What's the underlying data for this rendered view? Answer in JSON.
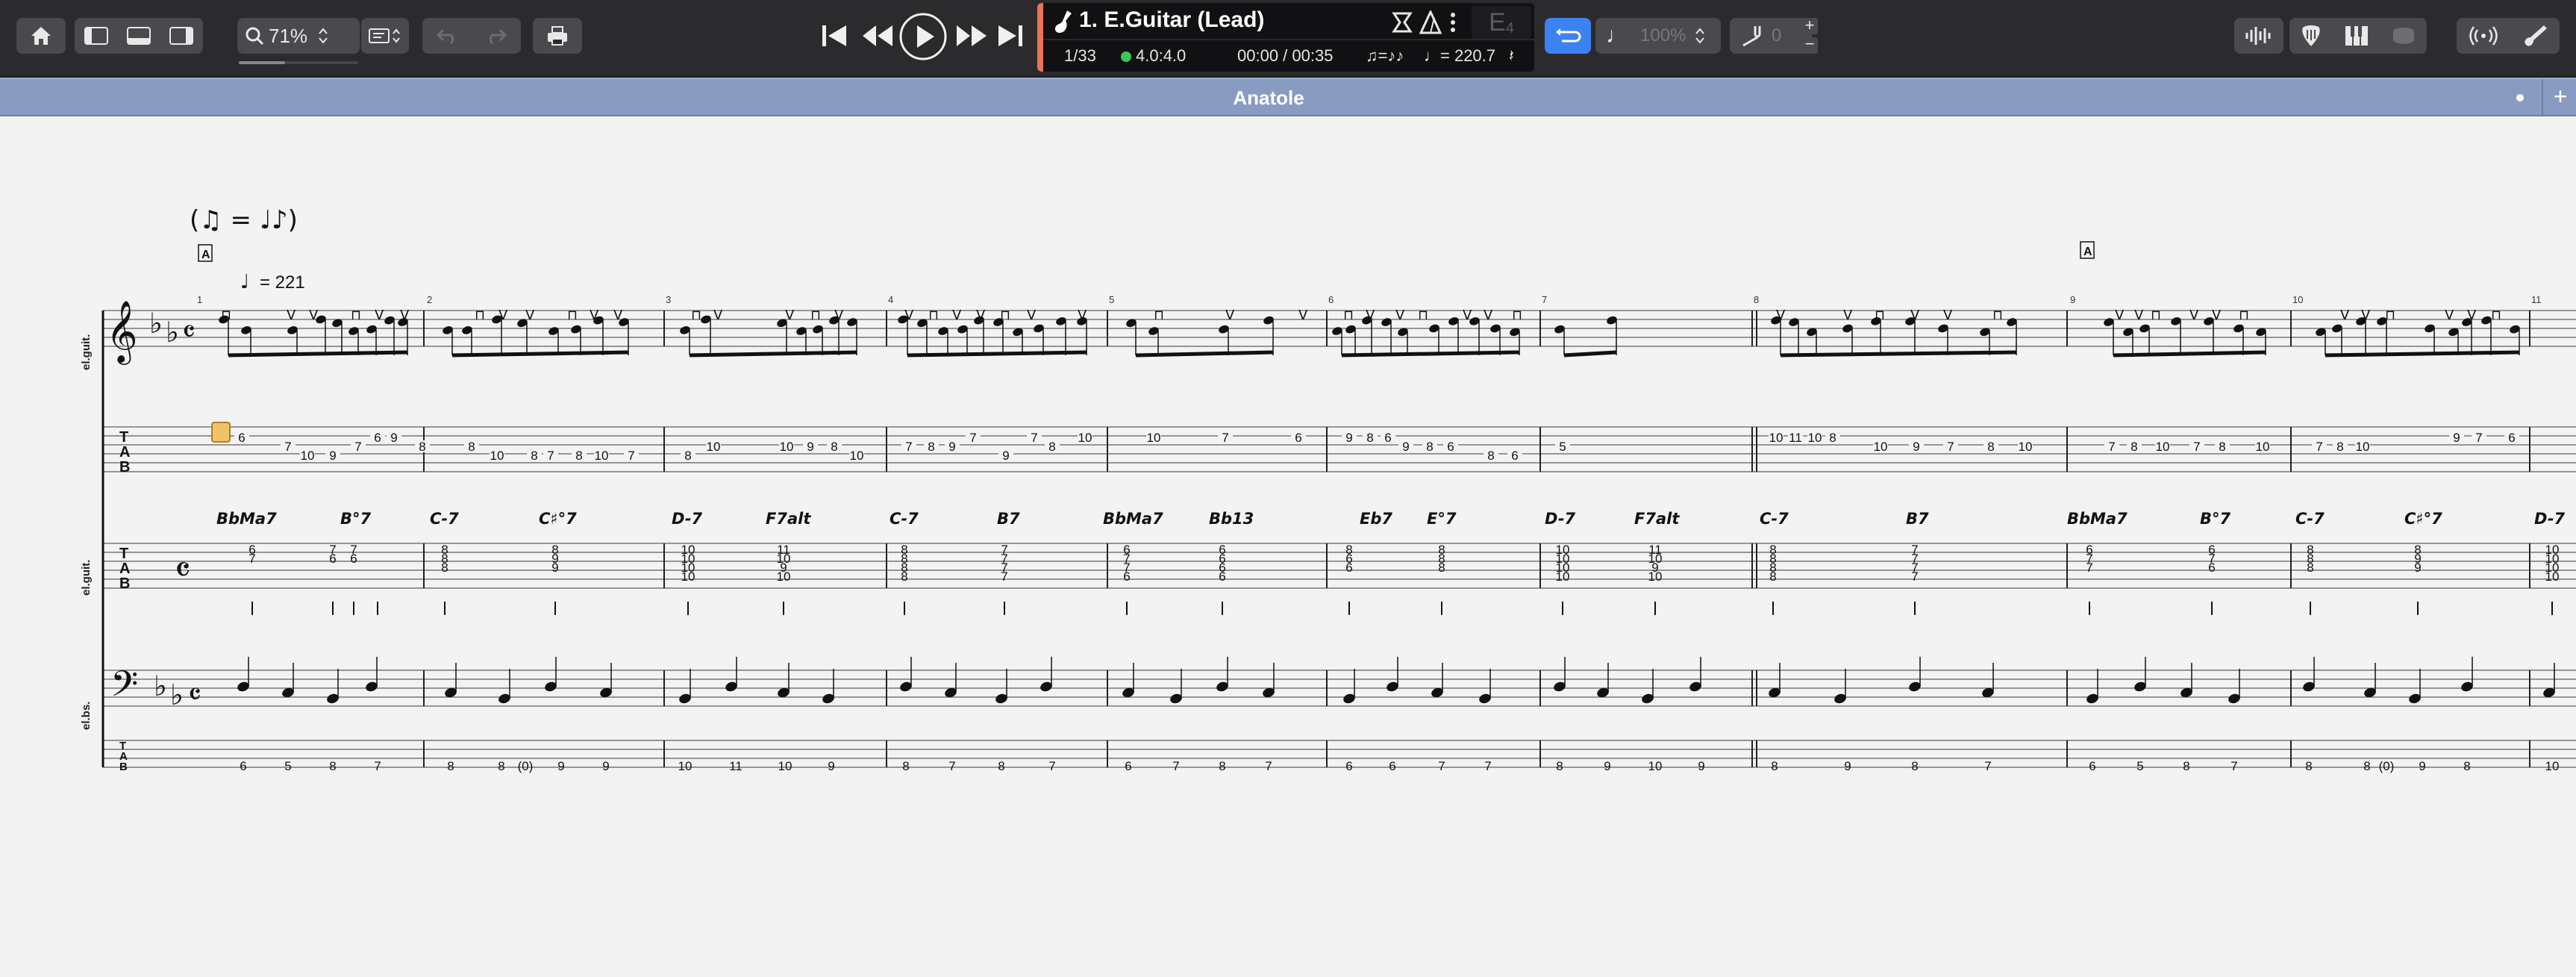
{
  "toolbar": {
    "zoom_value": "71%",
    "track_title": "1. E.Guitar (Lead)",
    "bar_position": "1/33",
    "time_signature": "4.0:4.0",
    "time_elapsed": "00:00 / 00:35",
    "tempo_value": "= 220.7",
    "key_label": "E",
    "key_sub": "4",
    "speed_value": "100%",
    "pitch_value": "0",
    "icons": [
      "home-icon",
      "layout-left-icon",
      "layout-bottom-icon",
      "layout-right-icon",
      "zoom-icon",
      "view-mode-icon",
      "undo-icon",
      "redo-icon",
      "print-icon",
      "skip-start-icon",
      "rewind-icon",
      "play-icon",
      "fast-forward-icon",
      "skip-end-icon",
      "guitar-icon",
      "metronome-icon",
      "tuner-icon",
      "more-icon",
      "loop-icon",
      "note-icon",
      "tuning-fork-icon",
      "waveform-icon",
      "guitar-pick-icon",
      "keyboard-icon",
      "drum-icon",
      "broadcast-icon",
      "guitar-tools-icon"
    ]
  },
  "document": {
    "title": "Anatole"
  },
  "score": {
    "tempo_mark": "= 221",
    "rehearsal_marks": [
      "A",
      "A"
    ],
    "staff_labels": [
      "el.guit.",
      "el.guit.",
      "el.bs."
    ],
    "measure_numbers": [
      "1",
      "2",
      "3",
      "4",
      "5",
      "6",
      "7",
      "8",
      "9",
      "10",
      "11"
    ],
    "chords": [
      "BbMa7",
      "B°7",
      "C-7",
      "C♯°7",
      "D-7",
      "F7alt",
      "C-7",
      "B7",
      "BbMa7",
      "Bb13",
      "Eb7",
      "E°7",
      "D-7",
      "F7alt",
      "C-7",
      "B7",
      "BbMa7",
      "B°7",
      "C-7",
      "C♯°7",
      "D-7"
    ],
    "lead_tab": [
      [
        "6",
        "7",
        "10",
        "9",
        "7",
        "6",
        "9",
        "8"
      ],
      [
        "8",
        "10",
        "8",
        "7",
        "8",
        "10",
        "7"
      ],
      [
        "8",
        "10",
        "10",
        "9",
        "8",
        "10"
      ],
      [
        "7",
        "8",
        "9",
        "7",
        "9",
        "7",
        "8",
        "10"
      ],
      [
        "10",
        "7",
        "6"
      ],
      [
        "9",
        "8",
        "6",
        "9",
        "8",
        "6",
        "8",
        "6"
      ],
      [
        "5"
      ],
      [
        "10",
        "11",
        "10",
        "8",
        "10",
        "9",
        "7",
        "8",
        "10"
      ],
      [
        "7",
        "8",
        "10",
        "7",
        "8",
        "10"
      ],
      [
        "7",
        "8",
        "10",
        "9",
        "7",
        "6"
      ]
    ],
    "comp_tab": [
      [
        "6",
        "7",
        "7",
        "6",
        "7",
        "6"
      ],
      [
        "8",
        "8",
        "8",
        "8",
        "9",
        "9"
      ],
      [
        "10",
        "10",
        "10",
        "10",
        "11",
        "10",
        "9",
        "10"
      ],
      [
        "8",
        "8",
        "8",
        "8",
        "7",
        "7",
        "7",
        "7"
      ],
      [
        "6",
        "7",
        "7",
        "6",
        "6",
        "6",
        "6",
        "6"
      ],
      [
        "8",
        "6",
        "6",
        "8",
        "8",
        "8"
      ],
      [
        "10",
        "10",
        "10",
        "10",
        "11",
        "10",
        "9",
        "10"
      ],
      [
        "8",
        "8",
        "8",
        "8",
        "7",
        "7",
        "7",
        "7"
      ],
      [
        "6",
        "7",
        "7",
        "6",
        "7",
        "6"
      ],
      [
        "8",
        "8",
        "8",
        "8",
        "9",
        "9"
      ],
      [
        "10",
        "10",
        "10",
        "10"
      ]
    ],
    "bass_tab": [
      [
        "6",
        "5",
        "8",
        "7"
      ],
      [
        "8",
        "8",
        "(0)",
        "9",
        "9"
      ],
      [
        "10",
        "11",
        "10",
        "9"
      ],
      [
        "8",
        "7",
        "8",
        "7"
      ],
      [
        "6",
        "7",
        "8",
        "7"
      ],
      [
        "6",
        "6",
        "7",
        "7"
      ],
      [
        "8",
        "9",
        "10",
        "9"
      ],
      [
        "8",
        "9",
        "8",
        "7"
      ],
      [
        "6",
        "5",
        "8",
        "7"
      ],
      [
        "8",
        "8",
        "(0)",
        "9",
        "8"
      ],
      [
        "10"
      ]
    ]
  }
}
